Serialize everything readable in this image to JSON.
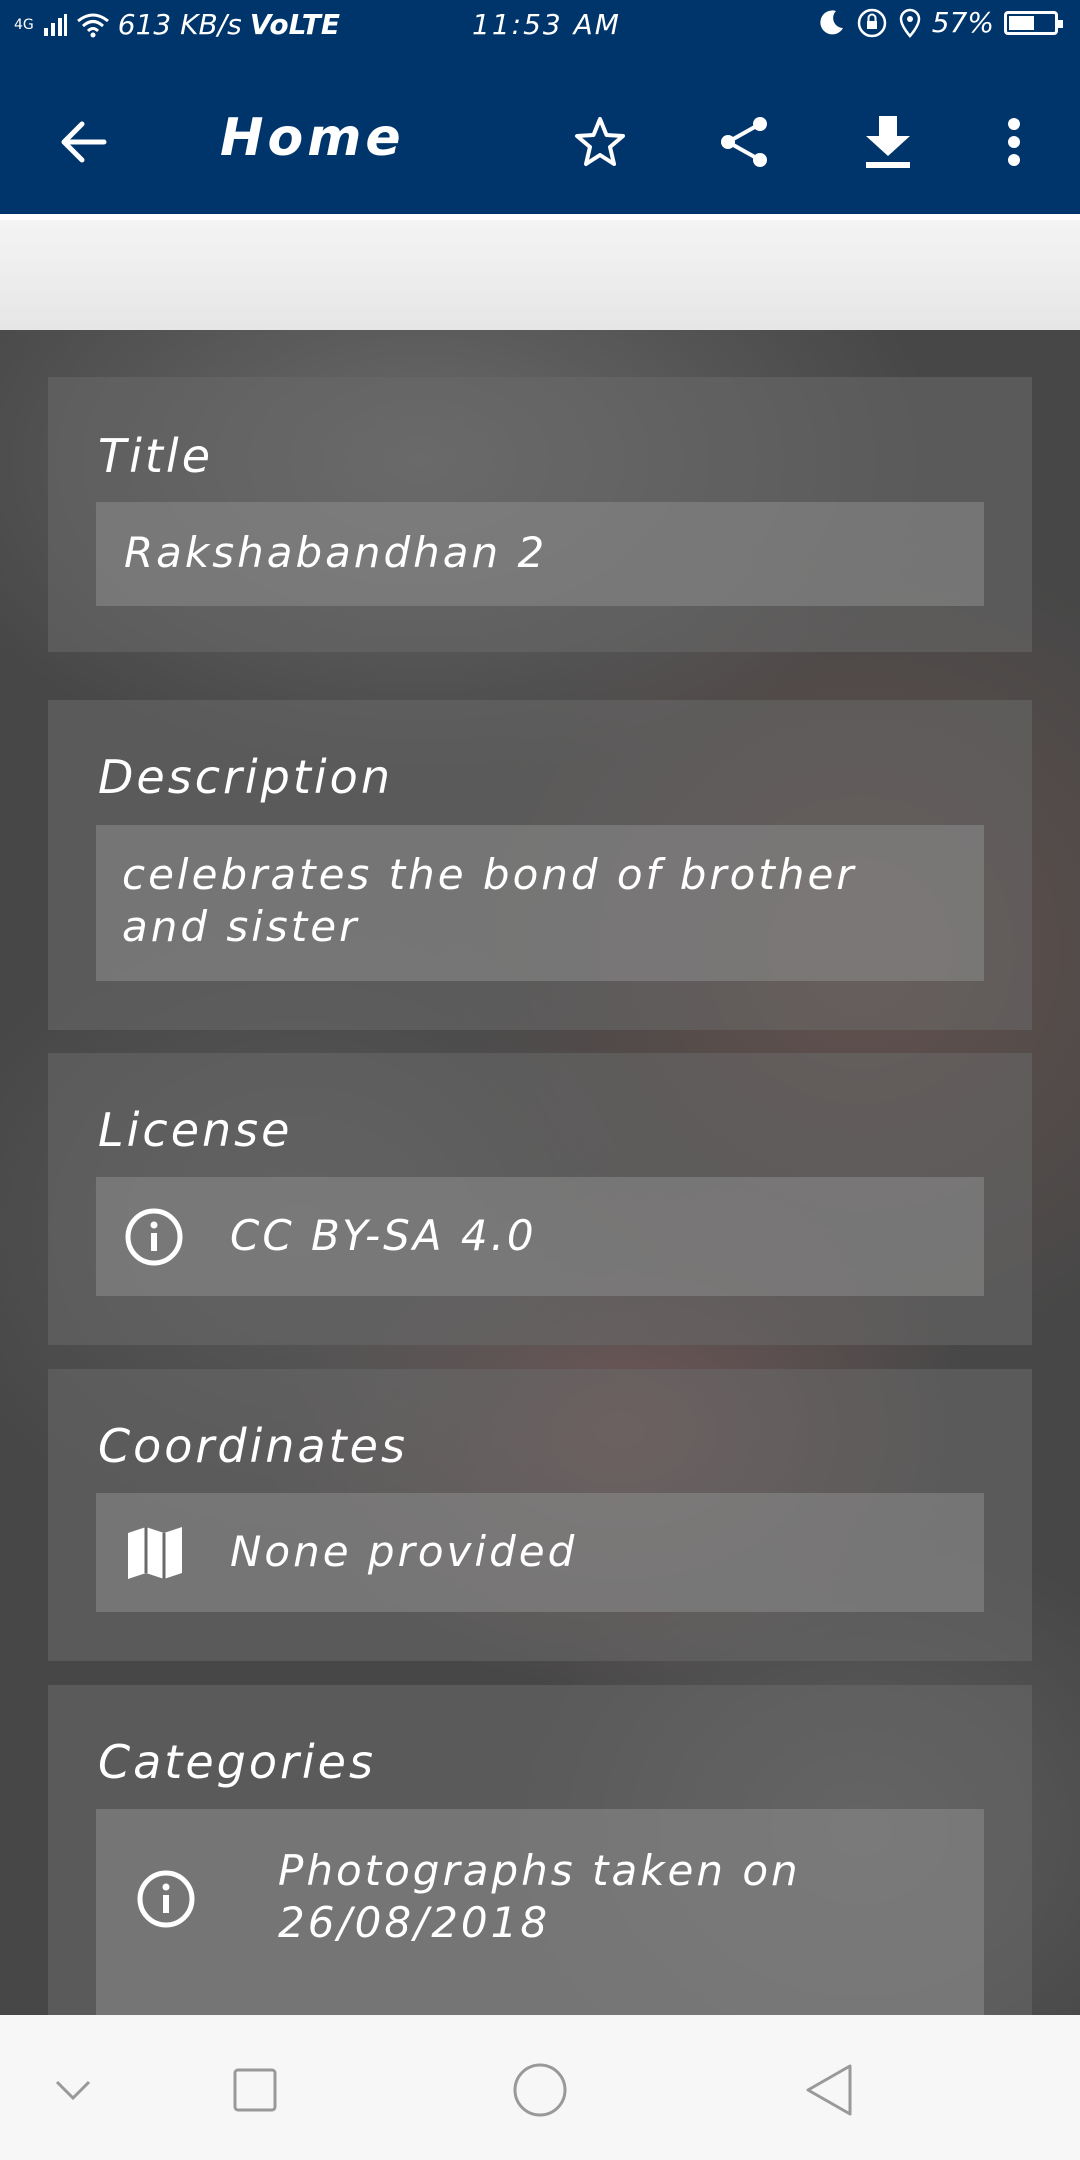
{
  "status_bar": {
    "network_type": "4G",
    "speed": "613 KB/s",
    "volte": "VoLTE",
    "time": "11:53 AM",
    "battery_percent": "57%",
    "battery_level": 0.57
  },
  "toolbar": {
    "title": "Home",
    "icons": [
      "back-arrow-icon",
      "star-icon",
      "share-icon",
      "download-icon",
      "more-vert-icon"
    ]
  },
  "details": {
    "title_label": "Title",
    "title_value": "Rakshabandhan 2",
    "description_label": "Description",
    "description_value": "celebrates the bond of brother and sister",
    "license_label": "License",
    "license_value": "CC BY-SA 4.0",
    "coordinates_label": "Coordinates",
    "coordinates_value": "None provided",
    "categories_label": "Categories",
    "categories_value": "Photographs taken on 26/08/2018"
  },
  "colors": {
    "app_bar": "#00356b",
    "nav_bar": "#f7f7f7"
  }
}
